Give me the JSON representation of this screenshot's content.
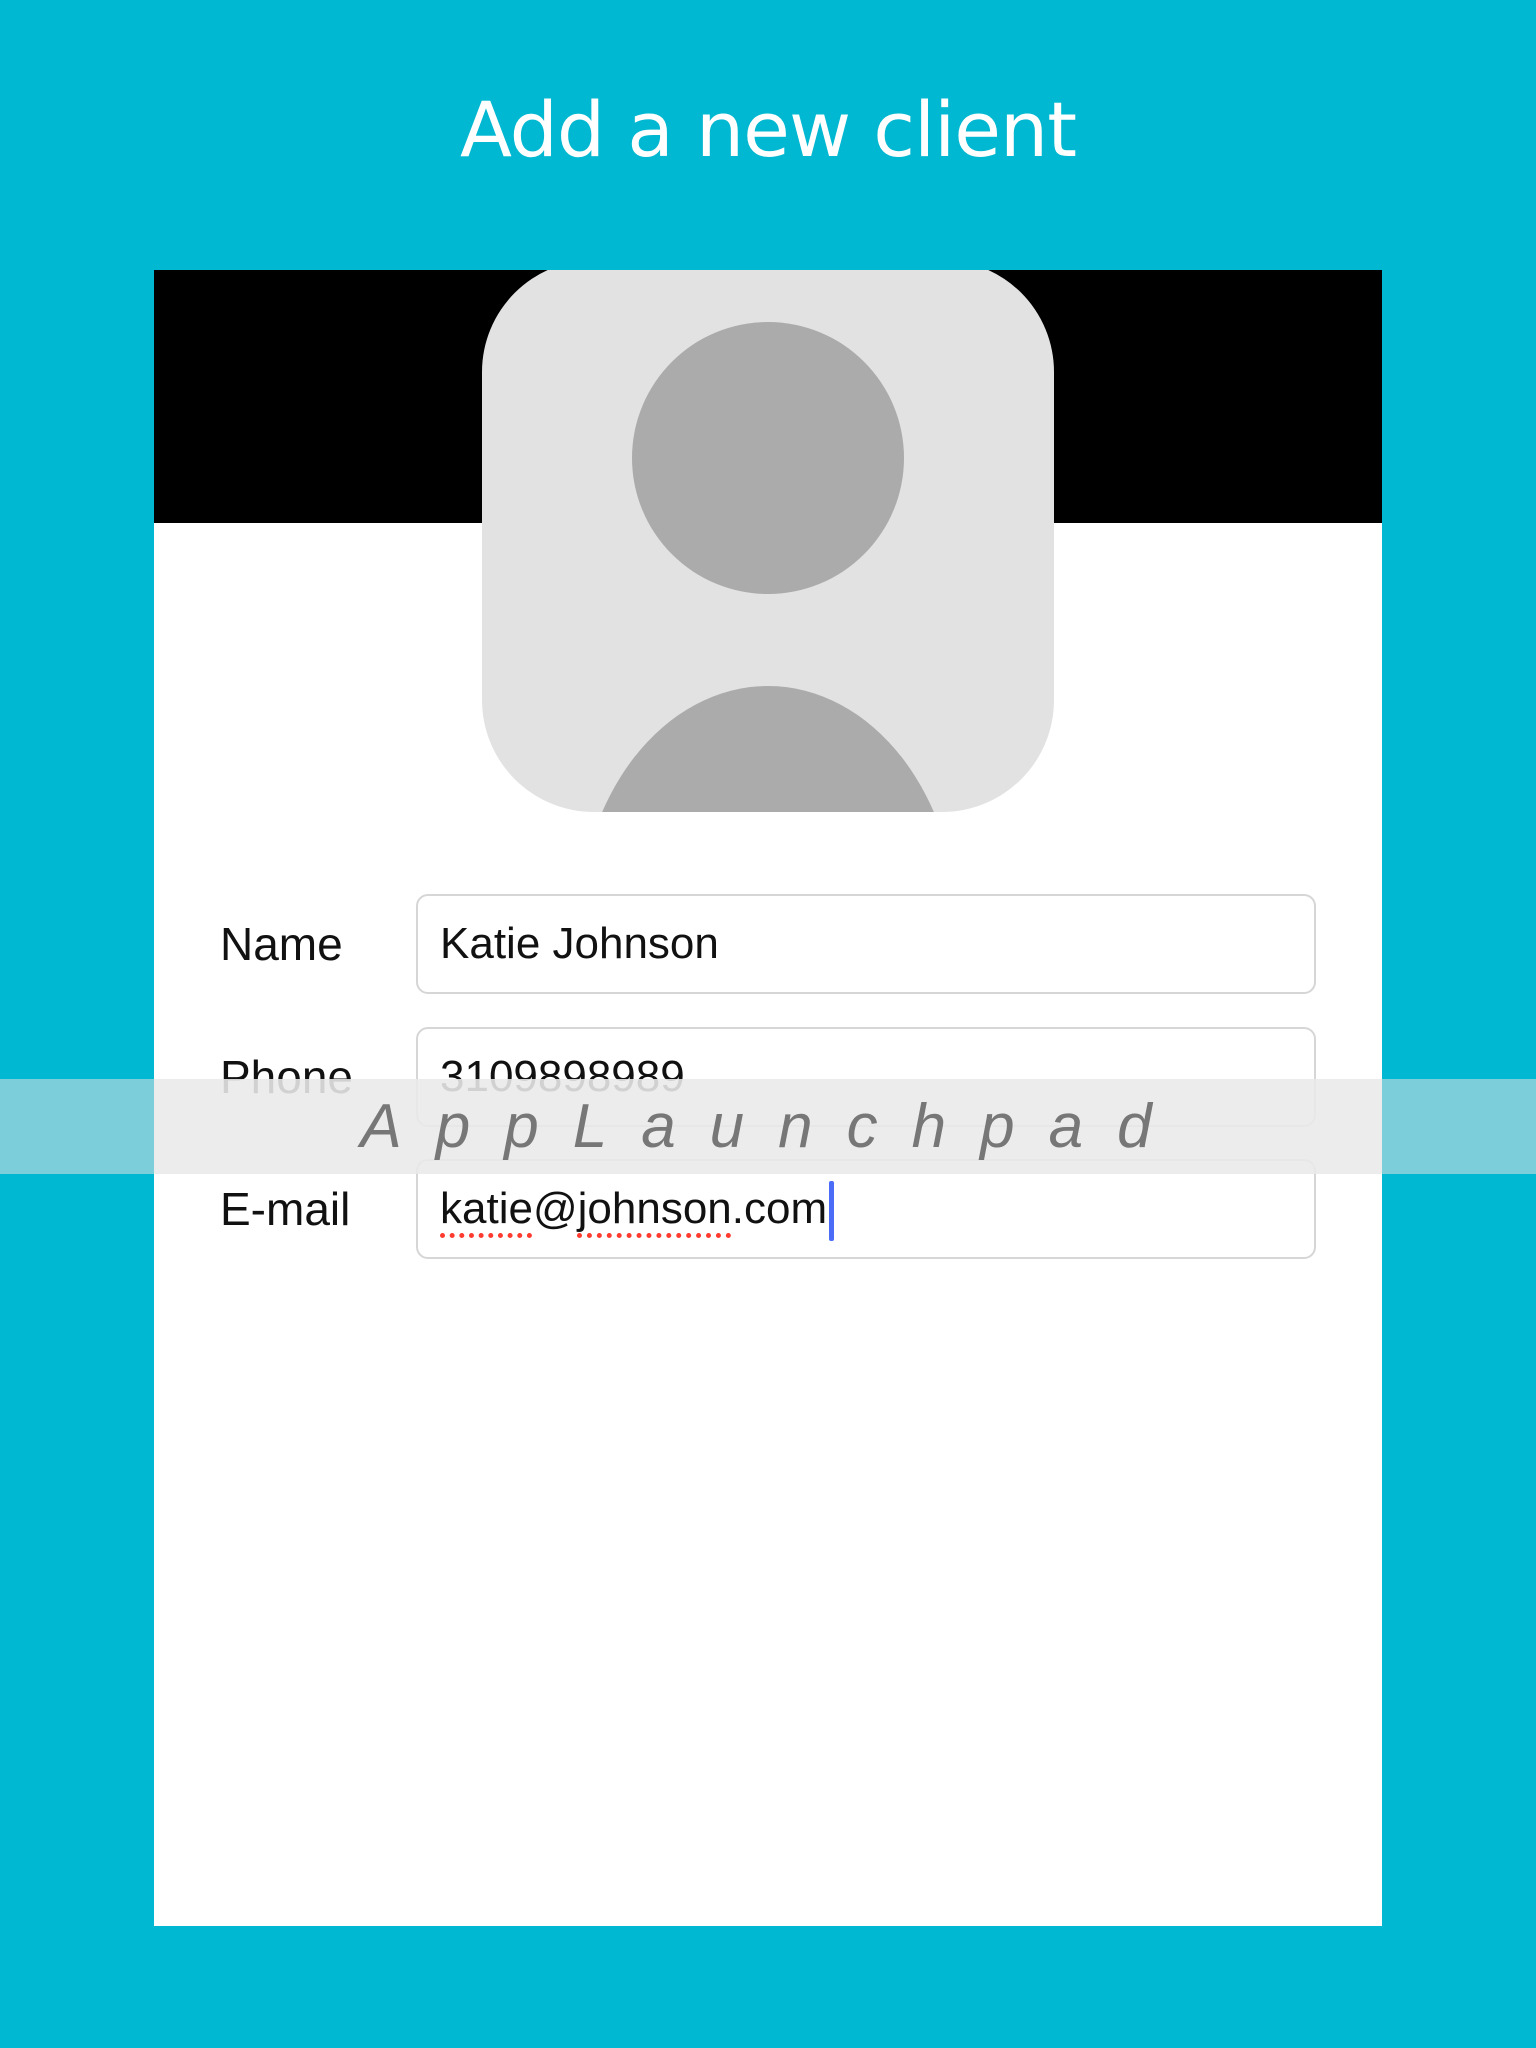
{
  "page": {
    "title": "Add a new client"
  },
  "avatar": {
    "icon": "person-placeholder-icon"
  },
  "form": {
    "name": {
      "label": "Name",
      "value": "Katie Johnson"
    },
    "phone": {
      "label": "Phone",
      "value": "3109898989"
    },
    "email": {
      "label": "E-mail",
      "value_part1": "katie",
      "value_part2": "@",
      "value_part3": "johnson",
      "value_part4": ".com"
    }
  },
  "watermark": {
    "text": "AppLaunchpad"
  },
  "colors": {
    "background": "#00b8d1",
    "header_band": "#000000",
    "avatar_bg": "#e2e2e2",
    "avatar_figure": "#ababab",
    "caret": "#4a6cf7",
    "spellcheck": "#ff3b30"
  }
}
